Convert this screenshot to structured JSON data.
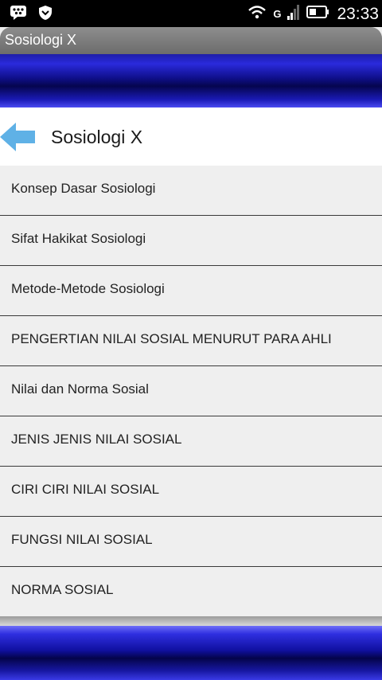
{
  "status_bar": {
    "time": "23:33",
    "network_label": "G",
    "icons": [
      "bbm-icon",
      "shield-icon",
      "wifi-icon",
      "signal-icon",
      "battery-icon"
    ]
  },
  "app_bar": {
    "title": "Sosiologi X"
  },
  "header": {
    "title": "Sosiologi X",
    "back_icon": "back-arrow-icon"
  },
  "menu": {
    "items": [
      {
        "label": "Konsep Dasar Sosiologi"
      },
      {
        "label": "Sifat Hakikat Sosiologi"
      },
      {
        "label": "Metode-Metode Sosiologi"
      },
      {
        "label": "PENGERTIAN NILAI SOSIAL MENURUT PARA AHLI"
      },
      {
        "label": "Nilai dan Norma Sosial"
      },
      {
        "label": "JENIS JENIS NILAI SOSIAL"
      },
      {
        "label": "CIRI CIRI NILAI SOSIAL"
      },
      {
        "label": "FUNGSI NILAI SOSIAL"
      },
      {
        "label": "NORMA SOSIAL"
      }
    ]
  },
  "colors": {
    "banner_blue": "#1a1ab4",
    "back_arrow": "#5fb1e6",
    "list_bg": "#efefef",
    "divider": "#3a3a3a"
  }
}
